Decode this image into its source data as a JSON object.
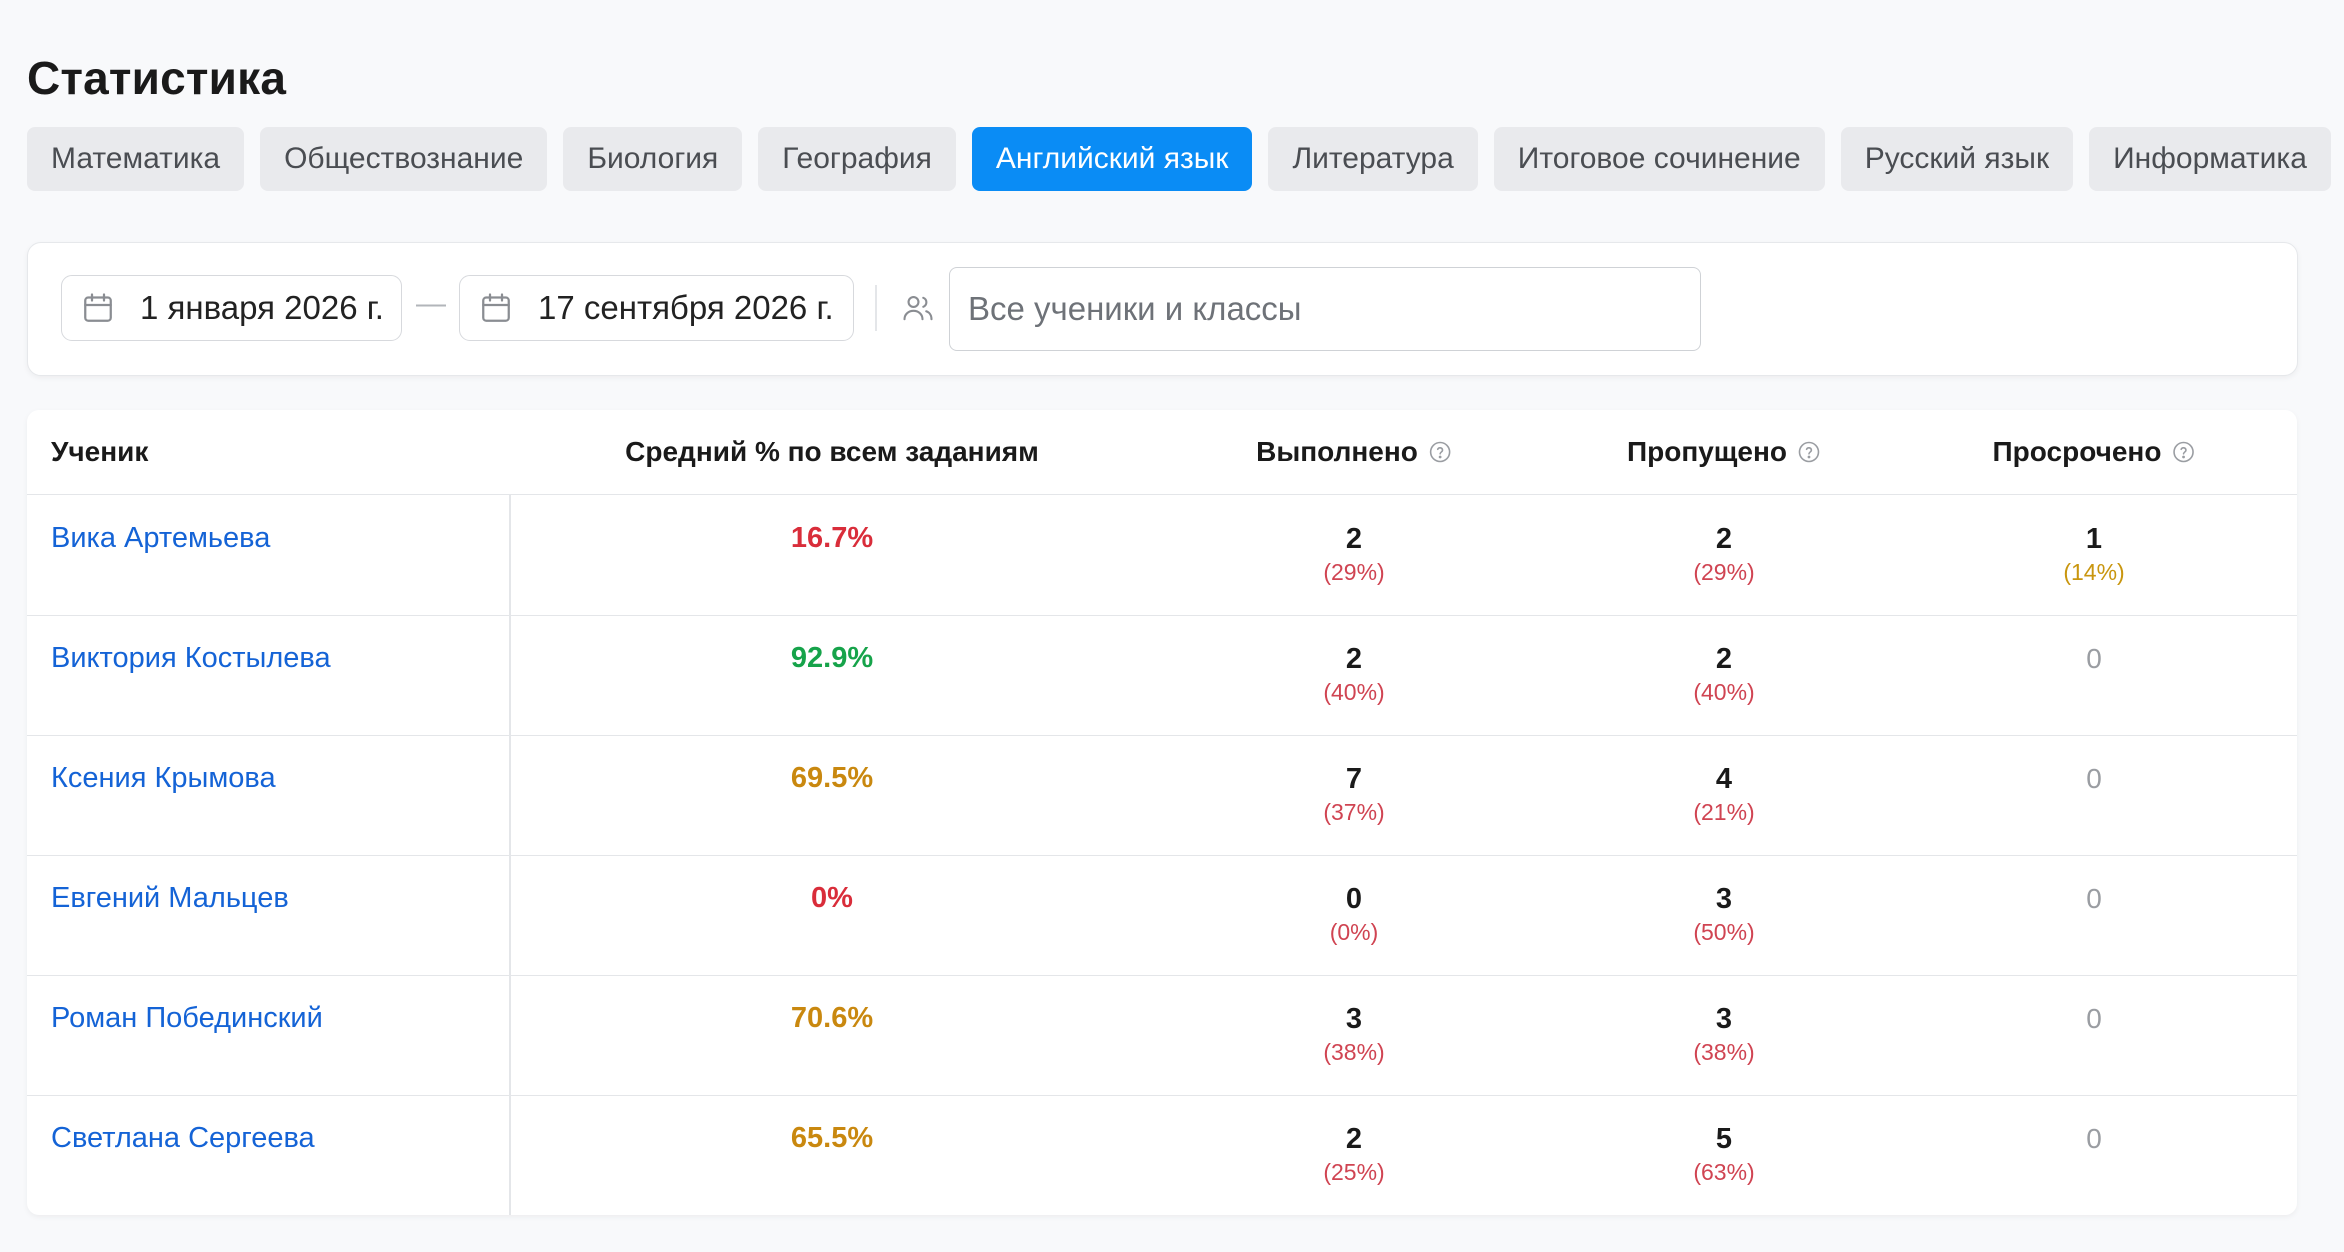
{
  "page_title": "Статистика",
  "tabs": [
    {
      "label": "Математика",
      "active": false
    },
    {
      "label": "Обществознание",
      "active": false
    },
    {
      "label": "Биология",
      "active": false
    },
    {
      "label": "География",
      "active": false
    },
    {
      "label": "Английский язык",
      "active": true
    },
    {
      "label": "Литература",
      "active": false
    },
    {
      "label": "Итоговое сочинение",
      "active": false
    },
    {
      "label": "Русский язык",
      "active": false
    },
    {
      "label": "Информатика",
      "active": false
    }
  ],
  "filters": {
    "date_from": "1 января 2026 г.",
    "dash": "—",
    "date_to": "17 сентября 2026 г.",
    "students_placeholder": "Все ученики и классы",
    "calendar_icon": "calendar-icon",
    "users_icon": "users-icon"
  },
  "table": {
    "headers": {
      "student": "Ученик",
      "avg": "Средний % по всем заданиям",
      "done": "Выполнено",
      "missed": "Пропущено",
      "overdue": "Просрочено"
    },
    "help_icon": "question-circle-icon",
    "colors": {
      "red": "#d92d3a",
      "green": "#16a34a",
      "amber": "#c9880f",
      "link": "#1463d6",
      "accent": "#0a8cf5"
    },
    "rows": [
      {
        "name": "Вика Артемьева",
        "avg": "16.7%",
        "avg_color": "red",
        "done": {
          "num": "2",
          "pct": "(29%)",
          "color": "red"
        },
        "missed": {
          "num": "2",
          "pct": "(29%)",
          "color": "red"
        },
        "overdue": {
          "num": "1",
          "pct": "(14%)",
          "color": "amber"
        }
      },
      {
        "name": "Виктория Костылева",
        "avg": "92.9%",
        "avg_color": "green",
        "done": {
          "num": "2",
          "pct": "(40%)",
          "color": "red"
        },
        "missed": {
          "num": "2",
          "pct": "(40%)",
          "color": "red"
        },
        "overdue": {
          "num": "0"
        }
      },
      {
        "name": "Ксения Крымова",
        "avg": "69.5%",
        "avg_color": "amber",
        "done": {
          "num": "7",
          "pct": "(37%)",
          "color": "red"
        },
        "missed": {
          "num": "4",
          "pct": "(21%)",
          "color": "red"
        },
        "overdue": {
          "num": "0"
        }
      },
      {
        "name": "Евгений Мальцев",
        "avg": "0%",
        "avg_color": "red",
        "done": {
          "num": "0",
          "pct": "(0%)",
          "color": "red"
        },
        "missed": {
          "num": "3",
          "pct": "(50%)",
          "color": "red"
        },
        "overdue": {
          "num": "0"
        }
      },
      {
        "name": "Роман Побединский",
        "avg": "70.6%",
        "avg_color": "amber",
        "done": {
          "num": "3",
          "pct": "(38%)",
          "color": "red"
        },
        "missed": {
          "num": "3",
          "pct": "(38%)",
          "color": "red"
        },
        "overdue": {
          "num": "0"
        }
      },
      {
        "name": "Светлана Сергеева",
        "avg": "65.5%",
        "avg_color": "amber",
        "done": {
          "num": "2",
          "pct": "(25%)",
          "color": "red"
        },
        "missed": {
          "num": "5",
          "pct": "(63%)",
          "color": "red"
        },
        "overdue": {
          "num": "0"
        }
      }
    ]
  }
}
